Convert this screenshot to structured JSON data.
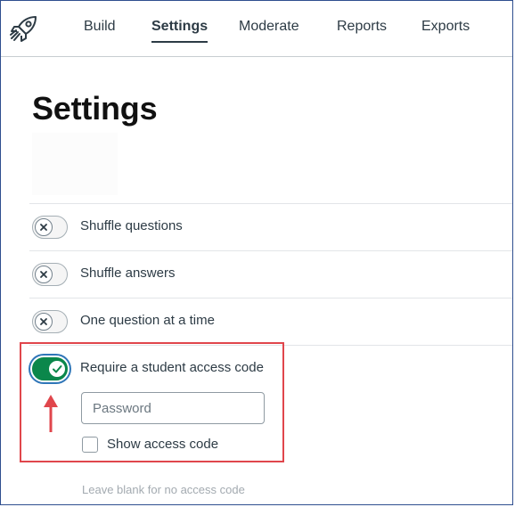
{
  "nav": {
    "tabs": [
      {
        "label": "Build",
        "active": false
      },
      {
        "label": "Settings",
        "active": true
      },
      {
        "label": "Moderate",
        "active": false
      },
      {
        "label": "Reports",
        "active": false
      },
      {
        "label": "Exports",
        "active": false
      }
    ]
  },
  "page": {
    "title": "Settings"
  },
  "settings": {
    "options": [
      {
        "label": "Shuffle questions",
        "enabled": false
      },
      {
        "label": "Shuffle answers",
        "enabled": false
      },
      {
        "label": "One question at a time",
        "enabled": false
      },
      {
        "label": "Require a student access code",
        "enabled": true
      }
    ],
    "access_code": {
      "value": "",
      "placeholder": "Password",
      "show_label": "Show access code",
      "show_checked": false,
      "hint": "Leave blank for no access code"
    }
  },
  "colors": {
    "toggle_on": "#0b874b",
    "focus_ring": "#2f76b8",
    "highlight": "#e0464c",
    "text": "#2d3b45"
  }
}
